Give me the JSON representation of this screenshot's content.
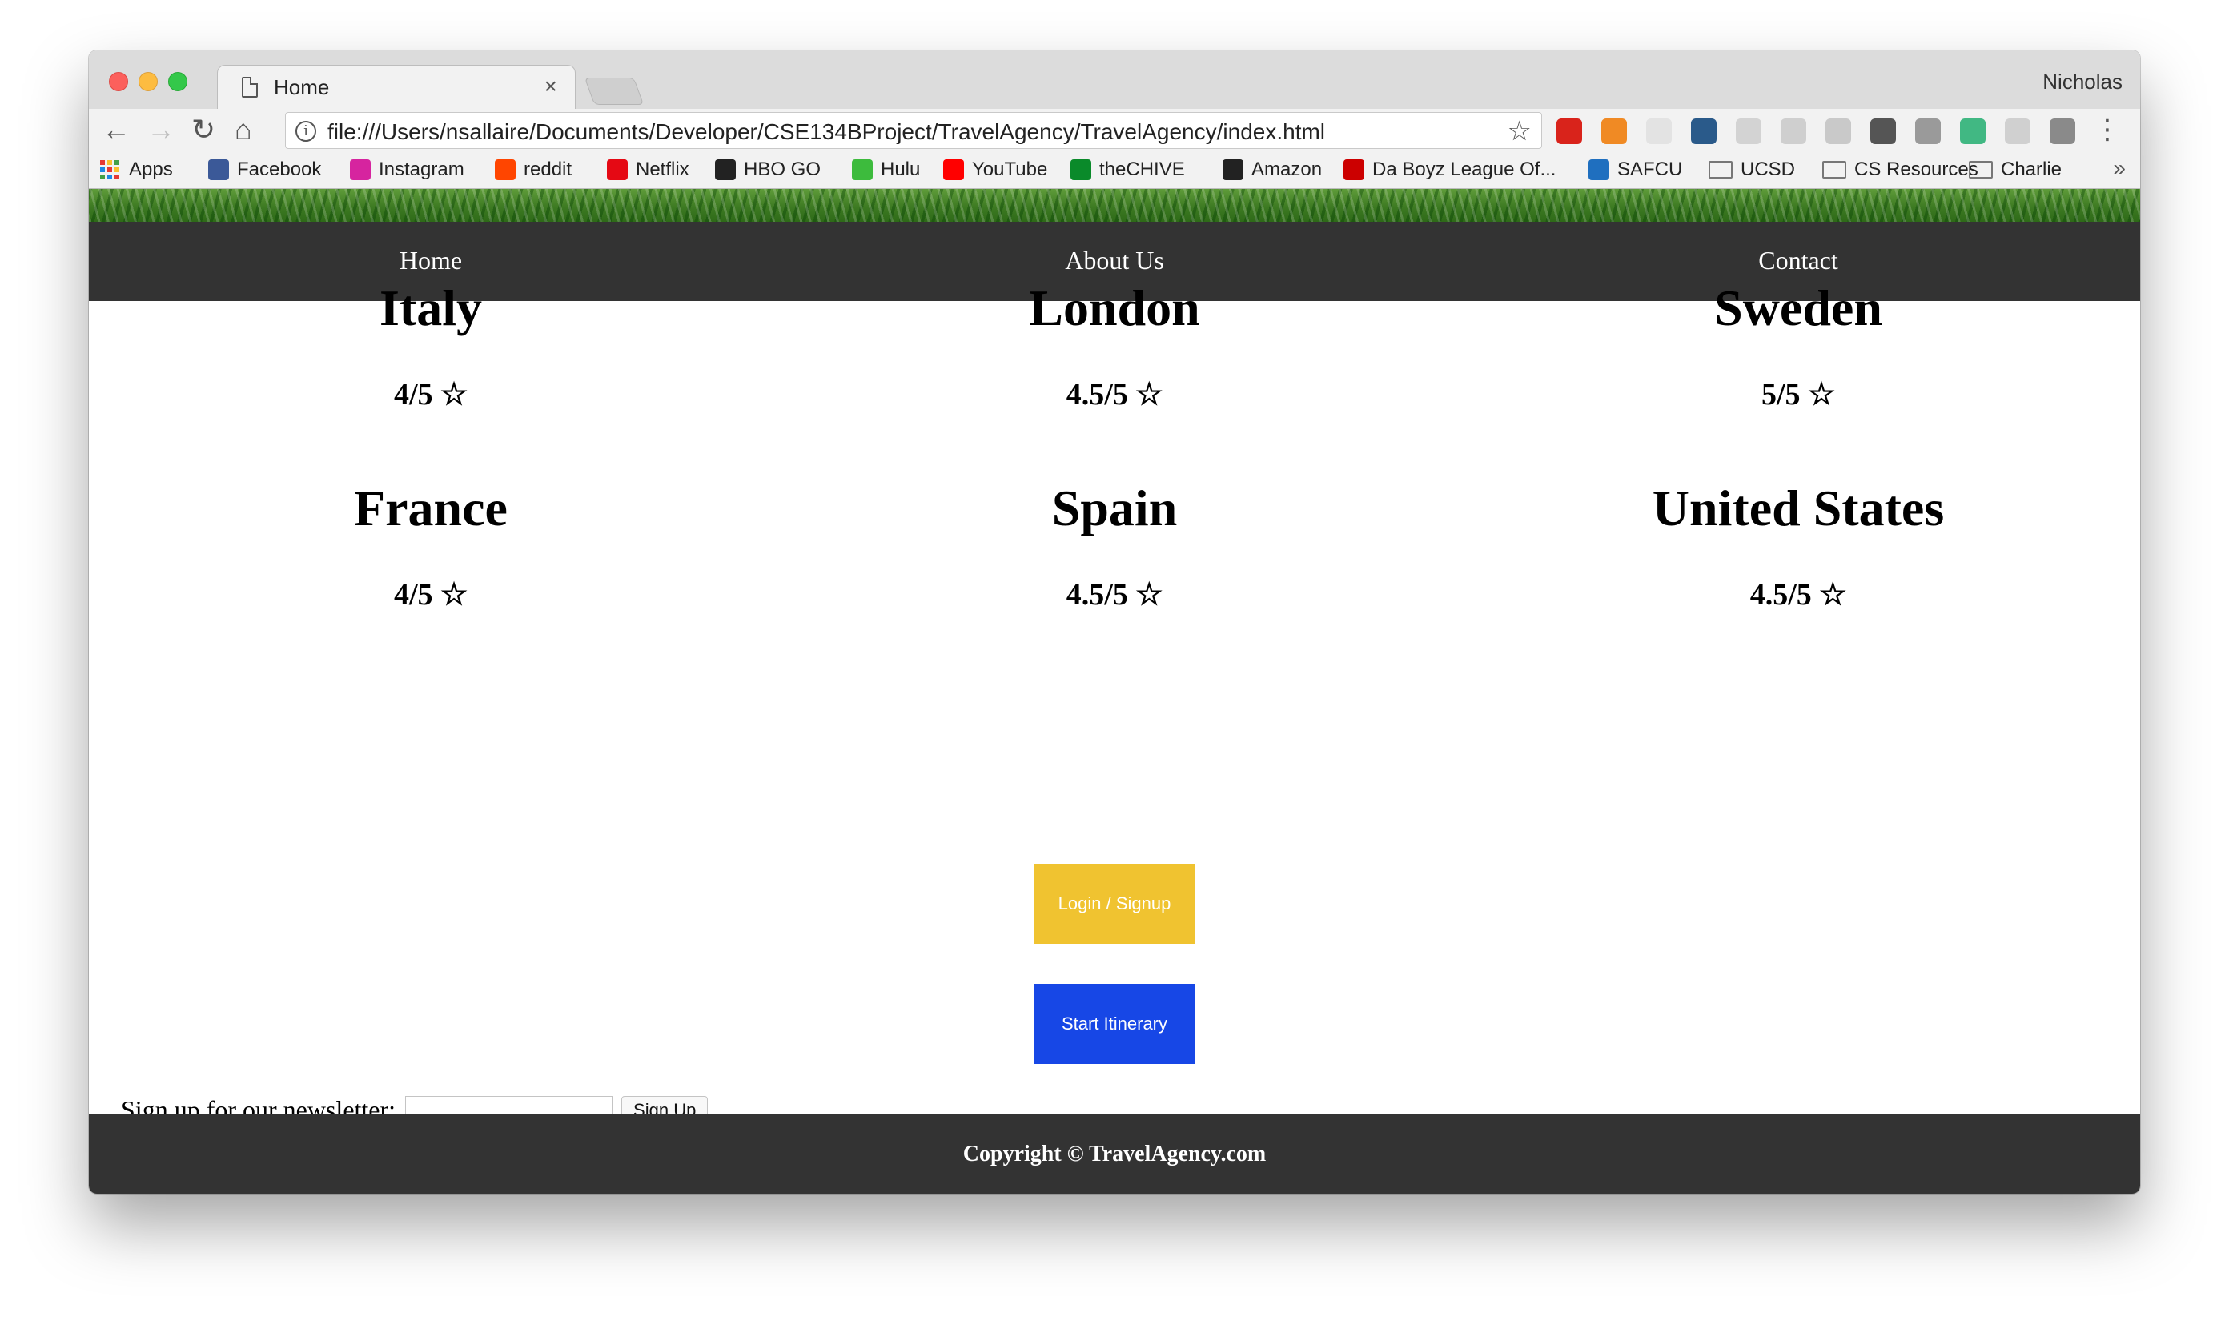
{
  "browser": {
    "tab_title": "Home",
    "tab_close": "×",
    "profile_name": "Nicholas",
    "url": "file:///Users/nsallaire/Documents/Developer/CSE134BProject/TravelAgency/TravelAgency/index.html",
    "nav_icons": {
      "back": "←",
      "forward": "→",
      "reload": "↻",
      "home": "⌂",
      "info": "i",
      "star": "☆",
      "menu": "⋮"
    },
    "extensions": [
      {
        "name": "adblock-icon",
        "color": "#d9231b"
      },
      {
        "name": "diamond-icon",
        "color": "#f08a24"
      },
      {
        "name": "hd-icon",
        "color": "#e3e3e3"
      },
      {
        "name": "gear-ext-icon",
        "color": "#2a5a8a"
      },
      {
        "name": "grid-ext-icon",
        "color": "#d3d3d3"
      },
      {
        "name": "css-ext-icon",
        "color": "#cfcfcf"
      },
      {
        "name": "r-ext-icon",
        "color": "#c9c9c9"
      },
      {
        "name": "wp-ext-icon",
        "color": "#555555"
      },
      {
        "name": "arrow-ext-icon",
        "color": "#9a9a9a"
      },
      {
        "name": "vue-ext-icon",
        "color": "#41b883"
      },
      {
        "name": "react-ext-icon",
        "color": "#d0d0d0"
      },
      {
        "name": "settings-ext-icon",
        "color": "#8a8a8a"
      }
    ],
    "bookmarks": [
      {
        "label": "Apps",
        "type": "apps"
      },
      {
        "label": "Facebook",
        "color": "#3b5998"
      },
      {
        "label": "Instagram",
        "color": "#d6249f"
      },
      {
        "label": "reddit",
        "color": "#ff4500"
      },
      {
        "label": "Netflix",
        "color": "#e50914"
      },
      {
        "label": "HBO GO",
        "color": "#222222"
      },
      {
        "label": "Hulu",
        "color": "#3dbb3d"
      },
      {
        "label": "YouTube",
        "color": "#ff0000"
      },
      {
        "label": "theCHIVE",
        "color": "#0a8a2a"
      },
      {
        "label": "Amazon",
        "color": "#222222"
      },
      {
        "label": "Da Boyz League Of...",
        "color": "#cc0000"
      },
      {
        "label": "SAFCU",
        "color": "#1f6fbf"
      },
      {
        "label": "UCSD",
        "type": "folder"
      },
      {
        "label": "CS Resources",
        "type": "folder"
      },
      {
        "label": "Charlie",
        "type": "folder"
      }
    ],
    "bookmarks_more": "»"
  },
  "site": {
    "nav": [
      "Home",
      "About Us",
      "Contact"
    ],
    "destinations": [
      {
        "name": "Italy",
        "rating": "4/5 ☆"
      },
      {
        "name": "London",
        "rating": "4.5/5 ☆"
      },
      {
        "name": "Sweden",
        "rating": "5/5 ☆"
      },
      {
        "name": "France",
        "rating": "4/5 ☆"
      },
      {
        "name": "Spain",
        "rating": "4.5/5 ☆"
      },
      {
        "name": "United States",
        "rating": "4.5/5 ☆"
      }
    ],
    "login_button": "Login / Signup",
    "itinerary_button": "Start Itinerary",
    "newsletter_label": "Sign up for our newsletter:",
    "newsletter_input_value": "",
    "newsletter_button": "Sign Up",
    "footer": "Copyright © TravelAgency.com",
    "colors": {
      "nav_bg": "#333333",
      "login": "#f0c330",
      "itinerary": "#1747e6"
    }
  }
}
